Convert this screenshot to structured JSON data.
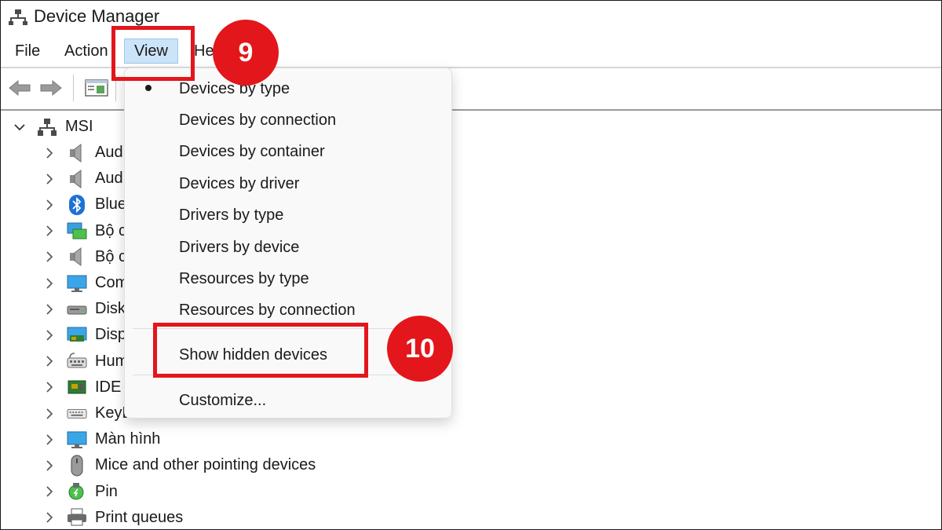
{
  "window": {
    "title": "Device Manager"
  },
  "menubar": {
    "file": "File",
    "action": "Action",
    "view": "View",
    "help": "He"
  },
  "toolbar": {
    "back_icon": "arrow-left-icon",
    "forward_icon": "arrow-right-icon",
    "properties_icon": "properties-icon"
  },
  "tree": {
    "root": {
      "label": "MSI",
      "icon": "computer-network-icon",
      "expanded": true
    },
    "items": [
      {
        "label": "Aud",
        "icon": "speaker-icon"
      },
      {
        "label": "Aud",
        "icon": "speaker-icon"
      },
      {
        "label": "Blue",
        "icon": "bluetooth-icon"
      },
      {
        "label": "Bộ c",
        "icon": "network-adapter-icon"
      },
      {
        "label": "Bộ c",
        "icon": "speaker-icon"
      },
      {
        "label": "Com",
        "icon": "monitor-icon"
      },
      {
        "label": "Disk",
        "icon": "disk-drive-icon"
      },
      {
        "label": "Disp",
        "icon": "display-adapter-icon"
      },
      {
        "label": "Hum",
        "icon": "keyboard-hid-icon"
      },
      {
        "label": "IDE",
        "icon": "ide-controller-icon"
      },
      {
        "label": "KeyL",
        "icon": "keyboard-icon"
      },
      {
        "label": "Màn hình",
        "icon": "monitor-icon"
      },
      {
        "label": "Mice and other pointing devices",
        "icon": "mouse-icon"
      },
      {
        "label": "Pin",
        "icon": "battery-icon"
      },
      {
        "label": "Print queues",
        "icon": "printer-icon"
      }
    ]
  },
  "view_menu": {
    "items": [
      {
        "label": "Devices by type",
        "checked": true
      },
      {
        "label": "Devices by connection"
      },
      {
        "label": "Devices by container"
      },
      {
        "label": "Devices by driver"
      },
      {
        "label": "Drivers by type"
      },
      {
        "label": "Drivers by device"
      },
      {
        "label": "Resources by type"
      },
      {
        "label": "Resources by connection"
      },
      {
        "label": "Show hidden devices"
      },
      {
        "label": "Customize..."
      }
    ]
  },
  "annotations": {
    "step_view": "9",
    "step_show_hidden": "10",
    "color": "#e3161b"
  }
}
